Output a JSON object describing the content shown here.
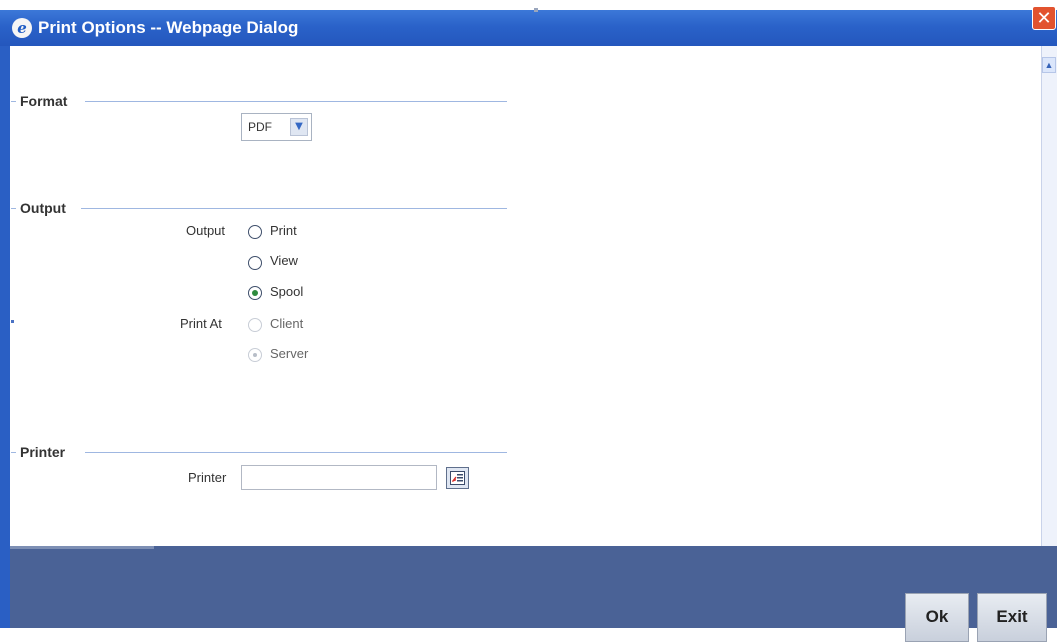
{
  "window": {
    "title": "Print Options -- Webpage Dialog",
    "app_icon_glyph": "e",
    "close_glyph": "✕"
  },
  "format": {
    "legend": "Format",
    "selected": "PDF",
    "arrow_glyph": "▼"
  },
  "output": {
    "legend": "Output",
    "output_label": "Output",
    "print_at_label": "Print At",
    "options": [
      {
        "label": "Print",
        "checked": false,
        "disabled": false
      },
      {
        "label": "View",
        "checked": false,
        "disabled": false
      },
      {
        "label": "Spool",
        "checked": true,
        "disabled": false
      }
    ],
    "print_at_options": [
      {
        "label": "Client",
        "checked": false,
        "disabled": true
      },
      {
        "label": "Server",
        "checked": true,
        "disabled": true
      }
    ]
  },
  "printer": {
    "legend": "Printer",
    "label": "Printer",
    "value": ""
  },
  "footer": {
    "ok_label": "Ok",
    "exit_label": "Exit"
  },
  "scroll": {
    "up_glyph": "▲",
    "down_glyph": "▼"
  },
  "colors": {
    "titlebar": "#2a62c9",
    "footer": "#4a6296",
    "section_rule": "#9fb7e1",
    "radio_selected": "#2e8b3e"
  }
}
